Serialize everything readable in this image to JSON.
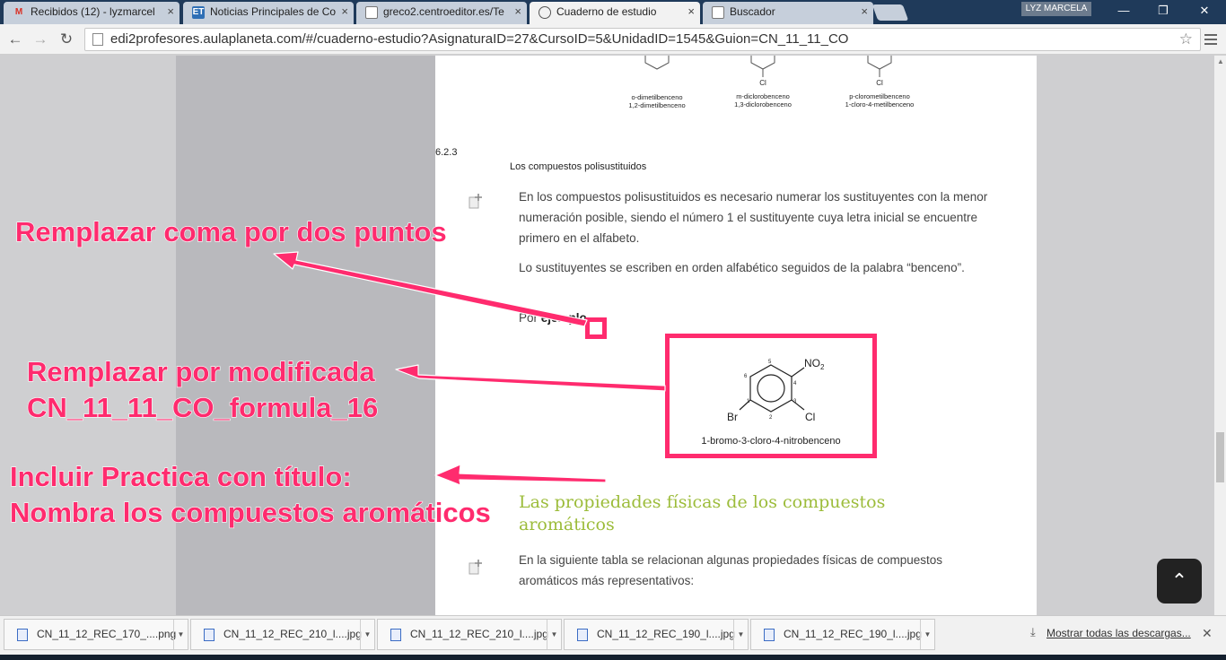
{
  "tabs": [
    {
      "title": "Recibidos (12) - lyzmarcel",
      "icon": "gmail-icon",
      "active": false
    },
    {
      "title": "Noticias Principales de Co",
      "icon": "et-icon",
      "active": false
    },
    {
      "title": "greco2.centroeditor.es/Te",
      "icon": "page-icon",
      "active": false
    },
    {
      "title": "Cuaderno de estudio",
      "icon": "globe-icon",
      "active": true
    },
    {
      "title": "Buscador",
      "icon": "page-icon",
      "active": false
    }
  ],
  "profile_name": "LYZ MARCELA",
  "address": "edi2profesores.aulaplaneta.com/#/cuaderno-estudio?AsignaturaID=27&CursoID=5&UnidadID=1545&Guion=CN_11_11_CO",
  "molecules_top": [
    {
      "name1": "o-dimetilbenceno",
      "name2": "1,2-dimetilbenceno"
    },
    {
      "name1": "m-diclorobenceno",
      "name2": "1,3-diclorobenceno",
      "sub": "Cl"
    },
    {
      "name1": "p-clorometilbenceno",
      "name2": "1-cloro-4-metilbenceno",
      "sub": "Cl"
    }
  ],
  "section": {
    "number": "6.2.3",
    "title": "Los compuestos polisustituidos",
    "para1": "En los compuestos polisustituidos es necesario numerar los sustituyentes con la menor numeración posible, siendo el número 1 el sustituyente cuya letra inicial se encuentre primero en el alfabeto.",
    "para2": "Lo sustituyentes se escriben en orden alfabético seguidos de la palabra “benceno”.",
    "para3_prefix": "Por ",
    "para3_bold": "ejemplo"
  },
  "formula_figure": {
    "caption": "1-bromo-3-cloro-4-nitrobenceno",
    "labels": {
      "no2": "NO",
      "no2_sub": "2",
      "br": "Br",
      "cl": "Cl",
      "n1": "1",
      "n2": "2",
      "n3": "3",
      "n4": "4",
      "n5": "5",
      "n6": "6"
    }
  },
  "section2": {
    "heading": "Las propiedades físicas de los compuestos aromáticos",
    "para": "En la siguiente tabla se relacionan algunas propiedades físicas de compuestos aromáticos más representativos:"
  },
  "annotations": {
    "a1": "Remplazar coma por dos puntos",
    "a2_line1": "Remplazar por modificada",
    "a2_line2": "CN_11_11_CO_formula_16",
    "a3_line1": "Incluir Practica con título:",
    "a3_line2": "Nombra los compuestos aromáticos",
    "color": "#ff2b6e"
  },
  "downloads": [
    {
      "name": "CN_11_12_REC_170_....png"
    },
    {
      "name": "CN_11_12_REC_210_l....jpg"
    },
    {
      "name": "CN_11_12_REC_210_l....jpg"
    },
    {
      "name": "CN_11_12_REC_190_l....jpg"
    },
    {
      "name": "CN_11_12_REC_190_l....jpg"
    }
  ],
  "show_all_downloads": "Mostrar todas las descargas..."
}
